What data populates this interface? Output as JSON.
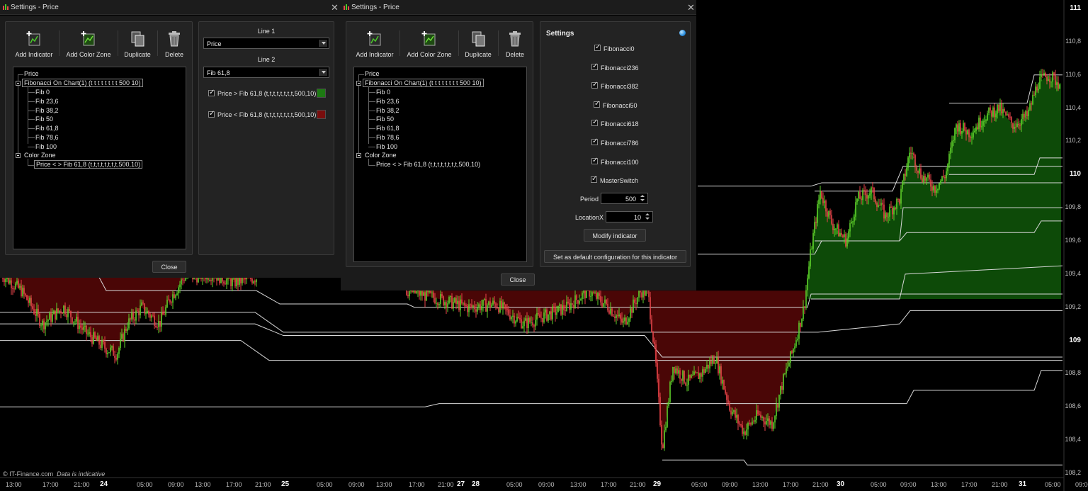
{
  "windows": [
    {
      "title": "Settings - Price",
      "toolbar": {
        "add_indicator": "Add Indicator",
        "add_color_zone": "Add Color Zone",
        "duplicate": "Duplicate",
        "delete": "Delete"
      },
      "tree": {
        "root": "Price",
        "indicator": "Fibonacci On Chart(1) (t t t t t t t t 500 10)",
        "fibs": [
          "Fib 0",
          "Fib 23,6",
          "Fib 38,2",
          "Fib 50",
          "Fib 61,8",
          "Fib 78,6",
          "Fib 100"
        ],
        "color_zone": "Color Zone",
        "zone_item": "Price < > Fib 61,8 (t,t,t,t,t,t,t,t,500,10)"
      },
      "close": "Close"
    },
    {
      "title": "Settings - Price",
      "toolbar": {
        "add_indicator": "Add Indicator",
        "add_color_zone": "Add Color Zone",
        "duplicate": "Duplicate",
        "delete": "Delete"
      },
      "tree": {
        "root": "Price",
        "indicator": "Fibonacci On Chart(1) (t t t t t t t t 500 10)",
        "fibs": [
          "Fib 0",
          "Fib 23,6",
          "Fib 38,2",
          "Fib 50",
          "Fib 61,8",
          "Fib 78,6",
          "Fib 100"
        ],
        "color_zone": "Color Zone",
        "zone_item": "Price < > Fib 61,8 (t,t,t,t,t,t,t,t,500,10)"
      },
      "close": "Close"
    }
  ],
  "zone_panel": {
    "line1_label": "Line 1",
    "line1_value": "Price",
    "line2_label": "Line 2",
    "line2_value": "Fib 61,8",
    "cond_above": "Price > Fib 61,8 (t,t,t,t,t,t,t,t,500,10)",
    "cond_below": "Price < Fib 61,8 (t,t,t,t,t,t,t,t,500,10)",
    "color_above": "#1d7a12",
    "color_below": "#7a0d0d"
  },
  "settings_panel": {
    "title": "Settings",
    "checks": [
      "Fibonacci0",
      "Fibonacci236",
      "Fibonacci382",
      "Fibonacci50",
      "Fibonacci618",
      "Fibonacci786",
      "Fibonacci100",
      "MasterSwitch"
    ],
    "period_label": "Period",
    "period_value": "500",
    "location_label": "LocationX",
    "location_value": "10",
    "modify_button": "Modify indicator",
    "default_button": "Set as default configuration for this indicator"
  },
  "chart": {
    "copyright": "© IT-Finance.com",
    "disclaimer": "Data is indicative",
    "y_axis": [
      {
        "label": "111",
        "value": 111,
        "major": true
      },
      {
        "label": "110,8",
        "value": 110.8
      },
      {
        "label": "110,6",
        "value": 110.6
      },
      {
        "label": "110,4",
        "value": 110.4
      },
      {
        "label": "110,2",
        "value": 110.2
      },
      {
        "label": "110",
        "value": 110,
        "major": true
      },
      {
        "label": "109,8",
        "value": 109.8
      },
      {
        "label": "109,6",
        "value": 109.6
      },
      {
        "label": "109,4",
        "value": 109.4
      },
      {
        "label": "109,2",
        "value": 109.2
      },
      {
        "label": "109",
        "value": 109,
        "major": true
      },
      {
        "label": "108,8",
        "value": 108.8
      },
      {
        "label": "108,6",
        "value": 108.6
      },
      {
        "label": "108,4",
        "value": 108.4
      },
      {
        "label": "108,2",
        "value": 108.2
      }
    ],
    "x_axis": [
      {
        "label": "13:00"
      },
      {
        "label": "17:00"
      },
      {
        "label": "21:00"
      },
      {
        "label": "24",
        "major": true
      },
      {
        "label": "05:00"
      },
      {
        "label": "09:00"
      },
      {
        "label": "13:00"
      },
      {
        "label": "17:00"
      },
      {
        "label": "21:00"
      },
      {
        "label": "25",
        "major": true
      },
      {
        "label": "05:00"
      },
      {
        "label": "09:00"
      },
      {
        "label": "13:00"
      },
      {
        "label": "17:00"
      },
      {
        "label": "21:00"
      },
      {
        "label": "27",
        "major": true
      },
      {
        "label": "28",
        "major": true
      },
      {
        "label": "05:00"
      },
      {
        "label": "09:00"
      },
      {
        "label": "13:00"
      },
      {
        "label": "17:00"
      },
      {
        "label": "21:00"
      },
      {
        "label": "29",
        "major": true
      },
      {
        "label": "05:00"
      },
      {
        "label": "09:00"
      },
      {
        "label": "13:00"
      },
      {
        "label": "17:00"
      },
      {
        "label": "21:00"
      },
      {
        "label": "30",
        "major": true
      },
      {
        "label": "05:00"
      },
      {
        "label": "09:00"
      },
      {
        "label": "13:00"
      },
      {
        "label": "17:00"
      },
      {
        "label": "21:00"
      },
      {
        "label": "31",
        "major": true
      },
      {
        "label": "05:00"
      },
      {
        "label": "09:00"
      }
    ],
    "colors": {
      "up": "#5fd12a",
      "down": "#e8454a",
      "zone_up": "#0d4a08",
      "zone_down": "#4a0606",
      "fib_line": "#d8d8d8"
    }
  }
}
